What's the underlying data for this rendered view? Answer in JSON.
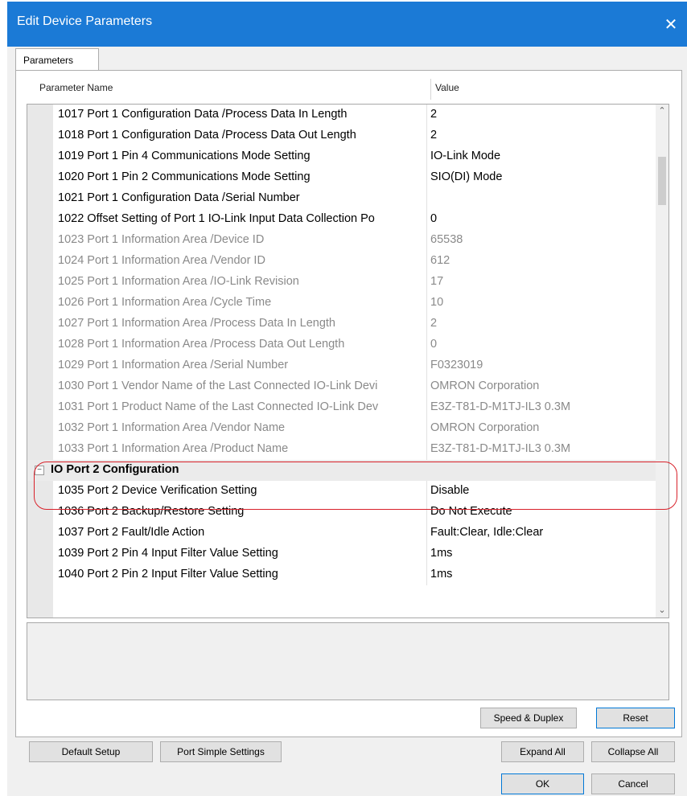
{
  "window": {
    "title": "Edit Device Parameters",
    "close_glyph": "✕"
  },
  "tabs": [
    {
      "label": "Parameters"
    }
  ],
  "table": {
    "headers": {
      "name": "Parameter Name",
      "value": "Value"
    },
    "rows": [
      {
        "name": "1017 Port 1 Configuration Data /Process Data In Length",
        "value": "2",
        "readonly": false
      },
      {
        "name": "1018 Port 1 Configuration Data /Process Data Out Length",
        "value": "2",
        "readonly": false
      },
      {
        "name": "1019 Port 1 Pin 4 Communications Mode Setting",
        "value": "IO-Link Mode",
        "readonly": false
      },
      {
        "name": "1020 Port 1 Pin 2 Communications Mode Setting",
        "value": "SIO(DI) Mode",
        "readonly": false
      },
      {
        "name": "1021 Port 1 Configuration Data /Serial Number",
        "value": "",
        "readonly": false
      },
      {
        "name": "1022 Offset Setting of Port 1 IO-Link Input Data Collection Po",
        "value": "0",
        "readonly": false
      },
      {
        "name": "1023 Port 1 Information Area /Device ID",
        "value": "65538",
        "readonly": true
      },
      {
        "name": "1024 Port 1 Information Area /Vendor ID",
        "value": "612",
        "readonly": true
      },
      {
        "name": "1025 Port 1 Information Area /IO-Link Revision",
        "value": "17",
        "readonly": true
      },
      {
        "name": "1026 Port 1 Information Area /Cycle Time",
        "value": "10",
        "readonly": true
      },
      {
        "name": "1027 Port 1 Information Area /Process Data In Length",
        "value": "2",
        "readonly": true
      },
      {
        "name": "1028 Port 1 Information Area /Process Data Out Length",
        "value": "0",
        "readonly": true
      },
      {
        "name": "1029 Port 1 Information Area /Serial Number",
        "value": "F0323019",
        "readonly": true
      },
      {
        "name": "1030 Port 1 Vendor Name of the Last Connected IO-Link Devi",
        "value": "OMRON Corporation",
        "readonly": true
      },
      {
        "name": "1031 Port 1 Product Name of the Last Connected IO-Link Dev",
        "value": "E3Z-T81-D-M1TJ-IL3 0.3M",
        "readonly": true
      },
      {
        "name": "1032 Port 1 Information Area /Vendor Name",
        "value": "OMRON Corporation",
        "readonly": true
      },
      {
        "name": "1033 Port 1 Information Area /Product Name",
        "value": "E3Z-T81-D-M1TJ-IL3 0.3M",
        "readonly": true
      }
    ],
    "group": {
      "label": "IO Port 2 Configuration",
      "toggle": "−"
    },
    "group_rows": [
      {
        "name": "1035 Port 2 Device Verification Setting",
        "value": "Disable",
        "readonly": false
      },
      {
        "name": "1036 Port 2 Backup/Restore Setting",
        "value": "Do Not Execute",
        "readonly": false
      },
      {
        "name": "1037 Port 2 Fault/Idle Action",
        "value": "Fault:Clear, Idle:Clear",
        "readonly": false
      },
      {
        "name": "1039 Port 2 Pin 4 Input Filter Value Setting",
        "value": "1ms",
        "readonly": false
      },
      {
        "name": "1040 Port 2 Pin 2 Input Filter Value Setting",
        "value": "1ms",
        "readonly": false
      }
    ]
  },
  "scrollbar": {
    "up_glyph": "⌃",
    "down_glyph": "⌄"
  },
  "buttons": {
    "speed_duplex": "Speed & Duplex",
    "reset": "Reset",
    "default_setup": "Default Setup",
    "port_simple_settings": "Port Simple Settings",
    "expand_all": "Expand All",
    "collapse_all": "Collapse All",
    "ok": "OK",
    "cancel": "Cancel"
  },
  "colors": {
    "titlebar": "#1b7ad6",
    "highlight": "#d8212a",
    "readonly_text": "#8a8a8a"
  }
}
